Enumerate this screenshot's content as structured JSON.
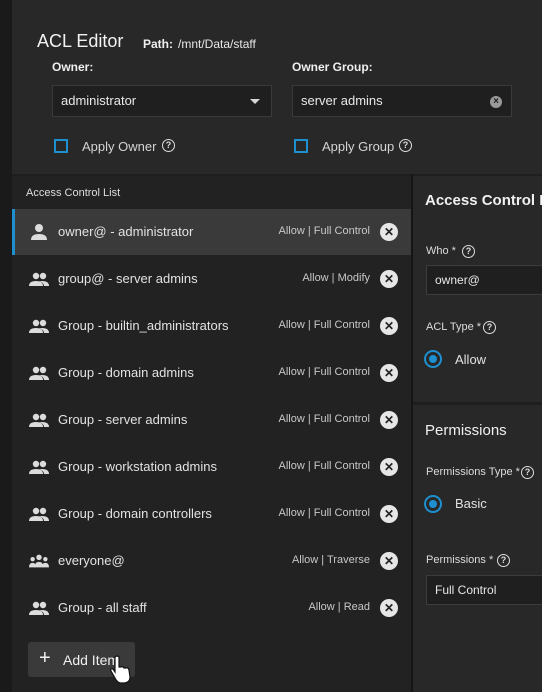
{
  "header": {
    "title": "ACL Editor",
    "path_label": "Path:",
    "path_value": "/mnt/Data/staff"
  },
  "owner": {
    "label": "Owner:",
    "value": "administrator",
    "apply_label": "Apply Owner"
  },
  "owner_group": {
    "label": "Owner Group:",
    "value": "server admins",
    "apply_label": "Apply Group"
  },
  "acl_list": {
    "header": "Access Control List",
    "items": [
      {
        "name": "owner@ - administrator",
        "perm": "Allow | Full Control",
        "icon": "user-icon",
        "selected": true
      },
      {
        "name": "group@ - server admins",
        "perm": "Allow | Modify",
        "icon": "group-icon"
      },
      {
        "name": "Group - builtin_administrators",
        "perm": "Allow | Full Control",
        "icon": "group-icon"
      },
      {
        "name": "Group - domain admins",
        "perm": "Allow | Full Control",
        "icon": "group-icon"
      },
      {
        "name": "Group - server admins",
        "perm": "Allow | Full Control",
        "icon": "group-icon"
      },
      {
        "name": "Group - workstation admins",
        "perm": "Allow | Full Control",
        "icon": "group-icon"
      },
      {
        "name": "Group - domain controllers",
        "perm": "Allow | Full Control",
        "icon": "group-icon"
      },
      {
        "name": "everyone@",
        "perm": "Allow | Traverse",
        "icon": "everyone-icon"
      },
      {
        "name": "Group - all staff",
        "perm": "Allow | Read",
        "icon": "group-icon"
      }
    ],
    "add_label": "Add Item"
  },
  "entry": {
    "title": "Access Control E",
    "who_label": "Who *",
    "who_value": "owner@",
    "acl_type_label": "ACL Type *",
    "acl_type_value": "Allow"
  },
  "permissions": {
    "title": "Permissions",
    "type_label": "Permissions Type *",
    "type_value": "Basic",
    "perm_label": "Permissions *",
    "perm_value": "Full Control"
  },
  "colors": {
    "accent": "#1e90d0",
    "panel": "#282828",
    "background": "#1e1e1e",
    "selected_row": "#3a3a3a"
  }
}
